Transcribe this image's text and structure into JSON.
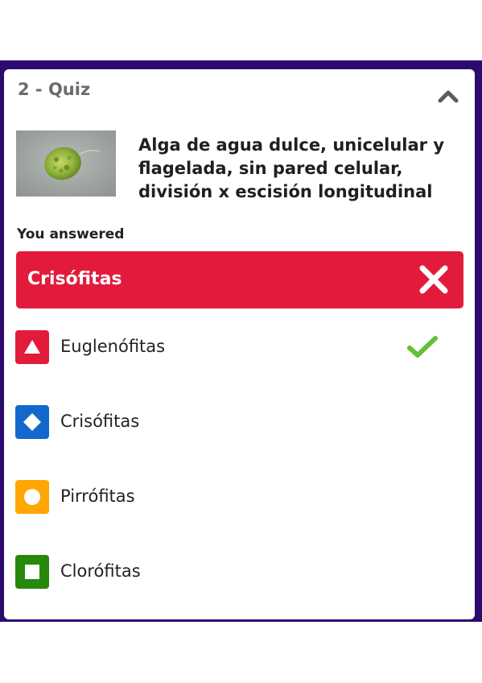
{
  "quiz": {
    "title": "2 - Quiz",
    "question": "Alga de agua dulce, unicelular y flagelada, sin pared celular, división x escisión longitudinal",
    "image_icon": "euglena-micrograph",
    "collapse_icon": "chevron-up-icon"
  },
  "result": {
    "heading": "You answered",
    "answer": "Crisófitas",
    "status_icon": "close-icon",
    "color": "#e21b3c"
  },
  "options": [
    {
      "label": "Euglenófitas",
      "icon": "triangle-icon",
      "color": "#e21b3c",
      "correct": true
    },
    {
      "label": "Crisófitas",
      "icon": "diamond-icon",
      "color": "#1368ce",
      "correct": false
    },
    {
      "label": "Pirrófitas",
      "icon": "circle-icon",
      "color": "#ffa602",
      "correct": false
    },
    {
      "label": "Clorófitas",
      "icon": "square-icon",
      "color": "#26890c",
      "correct": false
    }
  ],
  "colors": {
    "header_band": "#2c0a6e",
    "correct_check": "#66bf39"
  }
}
